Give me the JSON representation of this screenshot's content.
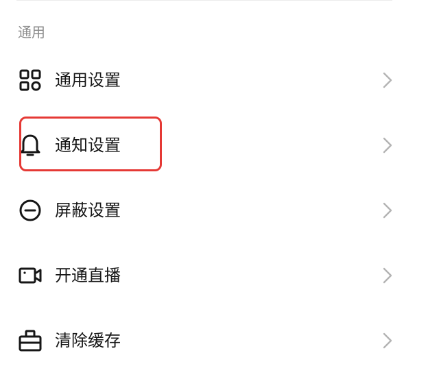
{
  "section": {
    "title": "通用"
  },
  "menu": {
    "items": [
      {
        "label": "通用设置",
        "icon": "grid-apps-icon"
      },
      {
        "label": "通知设置",
        "icon": "bell-icon"
      },
      {
        "label": "屏蔽设置",
        "icon": "block-icon"
      },
      {
        "label": "开通直播",
        "icon": "video-camera-icon"
      },
      {
        "label": "清除缓存",
        "icon": "toolbox-icon"
      }
    ]
  },
  "colors": {
    "text_primary": "#161616",
    "text_secondary": "#8a8a8a",
    "chevron": "#b4b4b4",
    "highlight": "#e53935"
  }
}
